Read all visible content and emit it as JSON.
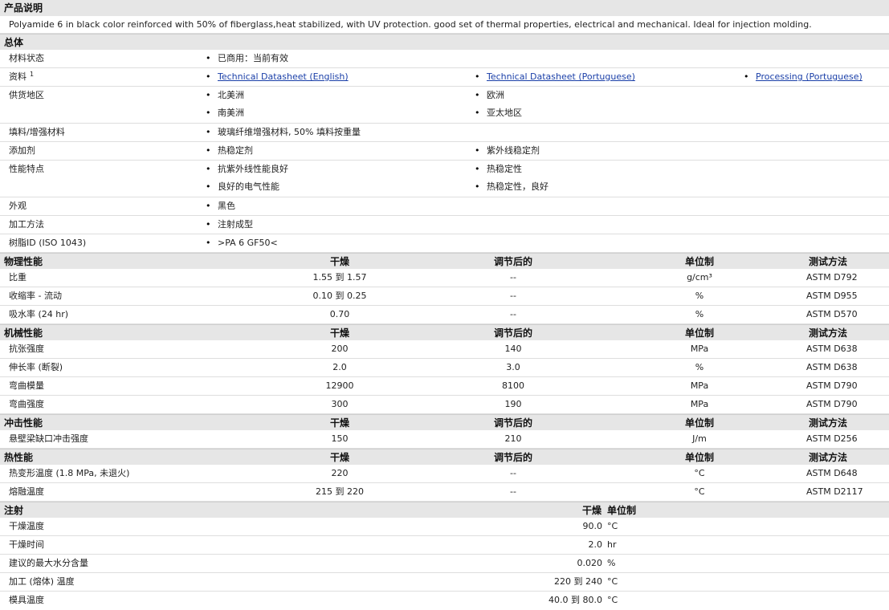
{
  "product": {
    "title": "产品说明",
    "description": "Polyamide 6 in black color reinforced with 50% of fiberglass,heat stabilized, with UV protection. good set of thermal properties, electrical and mechanical. Ideal for injection molding."
  },
  "general": {
    "title": "总体",
    "rows": {
      "status": {
        "label": "材料状态",
        "v1": "已商用：当前有效"
      },
      "docs": {
        "label": "资料",
        "sup": "1",
        "v1": "Technical Datasheet (English)",
        "v2": "Technical Datasheet (Portuguese)",
        "v3": "Processing (Portuguese)"
      },
      "region": {
        "label": "供货地区",
        "v1": "北美洲",
        "v2": "欧洲",
        "v3": "南美洲",
        "v4": "亚太地区"
      },
      "filler": {
        "label": "填料/增强材料",
        "v1": "玻璃纤维增强材料, 50% 填料按重量"
      },
      "additive": {
        "label": "添加剂",
        "v1": "热稳定剂",
        "v2": "紫外线稳定剂"
      },
      "features": {
        "label": "性能特点",
        "v1": "抗紫外线性能良好",
        "v2": "热稳定性",
        "v3": "良好的电气性能",
        "v4": "热稳定性，良好"
      },
      "appearance": {
        "label": "外观",
        "v1": "黑色"
      },
      "process": {
        "label": "加工方法",
        "v1": "注射成型"
      },
      "resin": {
        "label": "树脂ID (ISO 1043)",
        "v1": ">PA 6 GF50<"
      }
    }
  },
  "headers": {
    "dry": "干燥",
    "cond": "调节后的",
    "unit": "单位制",
    "method": "测试方法"
  },
  "physical": {
    "title": "物理性能",
    "rows": [
      {
        "label": "比重",
        "dry": "1.55 到  1.57",
        "cond": "--",
        "unit": "g/cm³",
        "method": "ASTM D792"
      },
      {
        "label": "收缩率 - 流动",
        "dry": "0.10 到  0.25",
        "cond": "--",
        "unit": "%",
        "method": "ASTM D955"
      },
      {
        "label": "吸水率 (24 hr)",
        "dry": "0.70",
        "cond": "--",
        "unit": "%",
        "method": "ASTM D570"
      }
    ]
  },
  "mechanical": {
    "title": "机械性能",
    "rows": [
      {
        "label": "抗张强度",
        "dry": "200",
        "cond": "140",
        "unit": "MPa",
        "method": "ASTM D638"
      },
      {
        "label": "伸长率 (断裂)",
        "dry": "2.0",
        "cond": "3.0",
        "unit": "%",
        "method": "ASTM D638"
      },
      {
        "label": "弯曲模量",
        "dry": "12900",
        "cond": "8100",
        "unit": "MPa",
        "method": "ASTM D790"
      },
      {
        "label": "弯曲强度",
        "dry": "300",
        "cond": "190",
        "unit": "MPa",
        "method": "ASTM D790"
      }
    ]
  },
  "impact": {
    "title": "冲击性能",
    "rows": [
      {
        "label": "悬壁梁缺口冲击强度",
        "dry": "150",
        "cond": "210",
        "unit": "J/m",
        "method": "ASTM D256"
      }
    ]
  },
  "thermal": {
    "title": "热性能",
    "rows": [
      {
        "label": "热变形温度 (1.8 MPa, 未退火)",
        "dry": "220",
        "cond": "--",
        "unit": "°C",
        "method": "ASTM D648"
      },
      {
        "label": "熔融温度",
        "dry": "215 到  220",
        "cond": "--",
        "unit": "°C",
        "method": "ASTM D2117"
      }
    ]
  },
  "injection": {
    "title": "注射",
    "dry": "干燥",
    "unit": "单位制",
    "rows": [
      {
        "label": "干燥温度",
        "value": "90.0",
        "unit": "°C"
      },
      {
        "label": "干燥时间",
        "value": "2.0",
        "unit": "hr"
      },
      {
        "label": "建议的最大水分含量",
        "value": "0.020",
        "unit": "%"
      },
      {
        "label": "加工 (熔体) 温度",
        "value": "220 到  240",
        "unit": "°C"
      },
      {
        "label": "模具温度",
        "value": "40.0 到  80.0",
        "unit": "°C"
      }
    ]
  }
}
